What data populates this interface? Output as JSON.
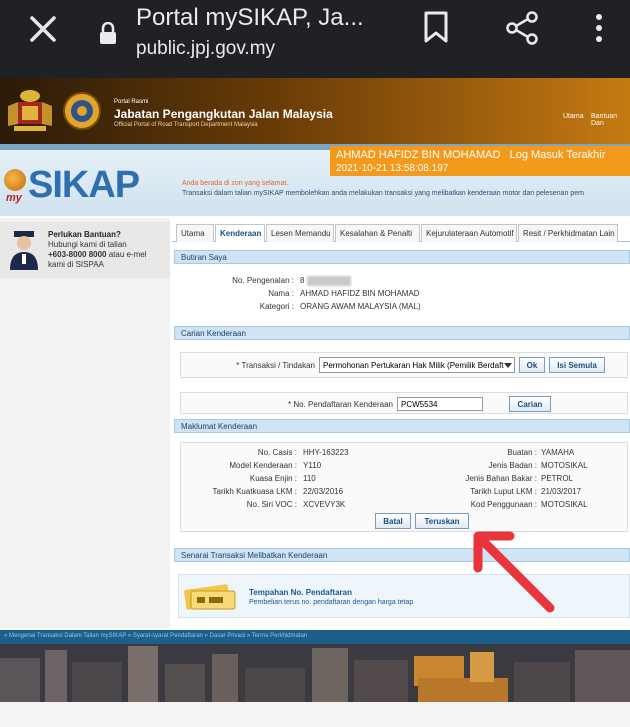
{
  "browser": {
    "page_title": "Portal mySIKAP, Ja...",
    "url": "public.jpj.gov.my"
  },
  "header": {
    "portal_label": "Portal Rasmi",
    "agency_name": "Jabatan Pengangkutan Jalan Malaysia",
    "agency_subtitle": "Official Portal of Road Transport Department Malaysia",
    "nav_home": "Utama",
    "nav_help": "Bantuan Dan"
  },
  "banner": {
    "logo_my": "my",
    "logo_sikap": "SIKAP",
    "user_name": "AHMAD HAFIDZ BIN MOHAMAD",
    "login_label": "Log Masuk Terakhir",
    "login_time": "2021-10-21 13:58:08.197",
    "location_text": "Anda berada di zon yang selamat.",
    "description": "Transaksi dalam talian mySIKAP membolehkan anda melakukan transaksi yang melibatkan kenderaan motor dan pelesenan pem"
  },
  "help": {
    "title": "Perlukan Bantuan?",
    "line1": "Hubungi kami di talian",
    "line2_phone": "+603-8000 8000",
    "line2_tail": "atau e-mel",
    "line3": "kami di SISPAA"
  },
  "tabs": [
    {
      "label": "Utama"
    },
    {
      "label": "Kenderaan"
    },
    {
      "label": "Lesen Memandu"
    },
    {
      "label": "Kesalahan & Penalti"
    },
    {
      "label": "Kejurulateraan Automotif"
    },
    {
      "label": "Resit / Perkhidmatan Lain"
    }
  ],
  "butiran": {
    "heading": "Butiran Saya",
    "id_label": "No. Pengenalan :",
    "id_value": "8",
    "name_label": "Nama :",
    "name_value": "AHMAD HAFIDZ BIN MOHAMAD",
    "category_label": "Kategori :",
    "category_value": "ORANG AWAM MALAYSIA (MAL)"
  },
  "carian": {
    "heading": "Carian Kenderaan",
    "transaction_label": "* Transaksi / Tindakan",
    "transaction_value": "Permohonan Pertukaran Hak Milik (Pemilik Berdaft",
    "ok_label": "Ok",
    "reset_label": "Isi Semula",
    "reg_label": "* No. Pendaftaran Kenderaan",
    "reg_value": "PCW5534",
    "search_label": "Carian"
  },
  "maklumat": {
    "heading": "Maklumat Kenderaan",
    "left": [
      {
        "label": "No. Casis :",
        "value": "HHY-163223"
      },
      {
        "label": "Model Kenderaan :",
        "value": "Y110"
      },
      {
        "label": "Kuasa Enjin :",
        "value": "110"
      },
      {
        "label": "Tarikh Kuatkuasa LKM :",
        "value": "22/03/2016"
      },
      {
        "label": "No. Siri VOC :",
        "value": "XCVEVY3K"
      }
    ],
    "right": [
      {
        "label": "Buatan :",
        "value": "YAMAHA"
      },
      {
        "label": "Jenis Badan :",
        "value": "MOTOSIKAL"
      },
      {
        "label": "Jenis Bahan Bakar :",
        "value": "PETROL"
      },
      {
        "label": "Tarikh Luput LKM :",
        "value": "21/03/2017"
      },
      {
        "label": "Kod Penggunaan :",
        "value": "MOTOSIKAL"
      }
    ],
    "cancel_label": "Batal",
    "continue_label": "Teruskan"
  },
  "senarai": {
    "heading": "Senarai Transaksi Melibatkan Kenderaan",
    "promo_title": "Tempahan No. Pendaftaran",
    "promo_text": "Pembelian terus no. pendaftaran dengan harga tetap"
  },
  "footer": {
    "links": "» Mengenai Transaksi Dalam Talian mySIKAP » Syarat-syarat Pendaftaran » Dasar Privasi » Terma Perkhidmatan"
  },
  "colors": {
    "chrome": "#202124",
    "header_dark": "#2a1a07",
    "header_orange": "#c67a12",
    "user_bar": "#f39a1c",
    "section_head": "#cfe3f3",
    "arrow": "#e8343a"
  },
  "icons": {
    "close": "close-icon",
    "lock": "lock-icon",
    "bookmark": "bookmark-icon",
    "share": "share-icon",
    "menu": "kebab-menu-icon"
  }
}
